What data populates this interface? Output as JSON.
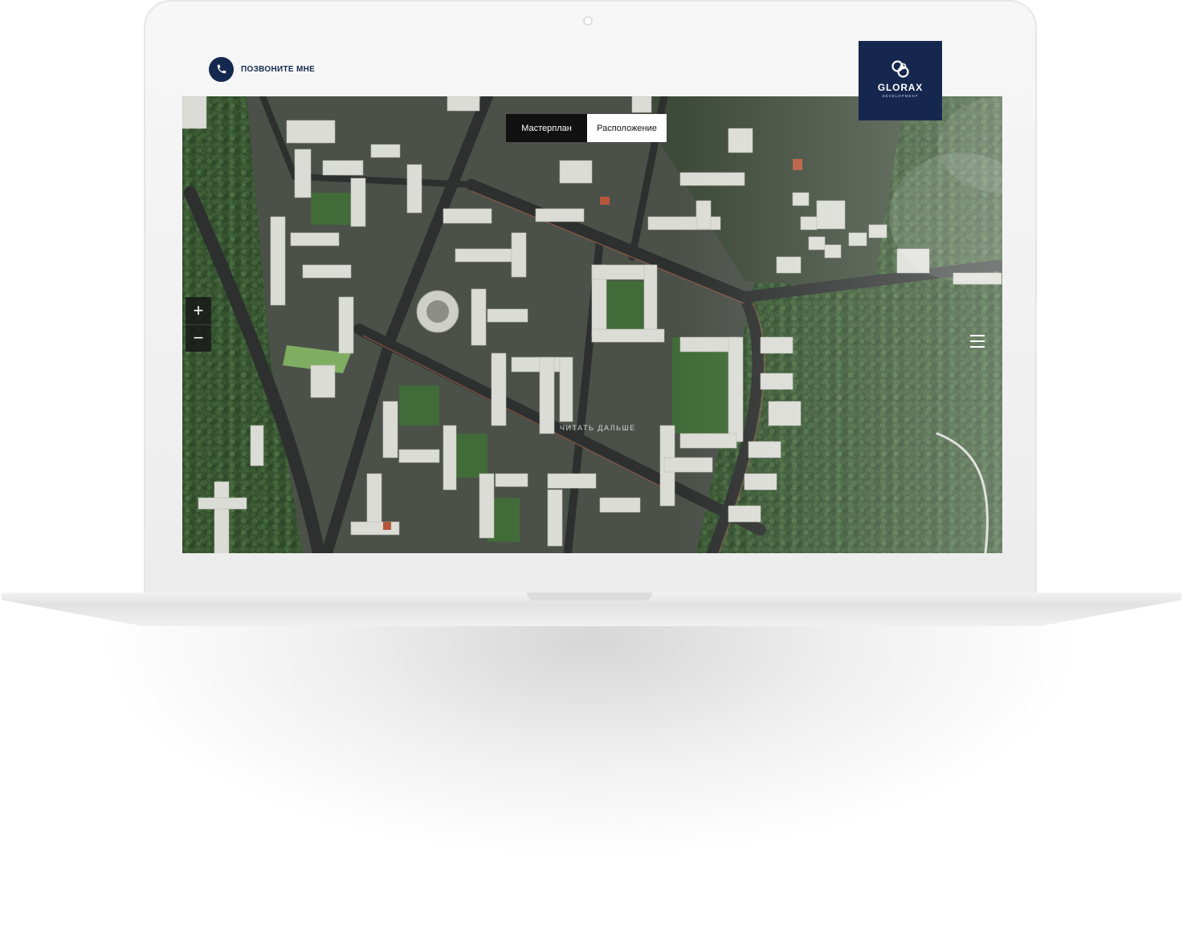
{
  "header": {
    "call_label": "ПОЗВОНИТЕ МНЕ"
  },
  "logo": {
    "name": "GLORAX",
    "subtitle": "DEVELOPMENT"
  },
  "tabs": [
    {
      "label": "Мастерплан",
      "active": true
    },
    {
      "label": "Расположение",
      "active": false
    }
  ],
  "zoom": {
    "in_label": "+",
    "out_label": "−"
  },
  "overlay": {
    "read_more": "ЧИТАТЬ ДАЛЬШЕ"
  },
  "colors": {
    "brand": "#16274f",
    "header_bg": "#f6f6f6",
    "tab_active_bg": "#111111",
    "forest": "#2f4a2d"
  }
}
